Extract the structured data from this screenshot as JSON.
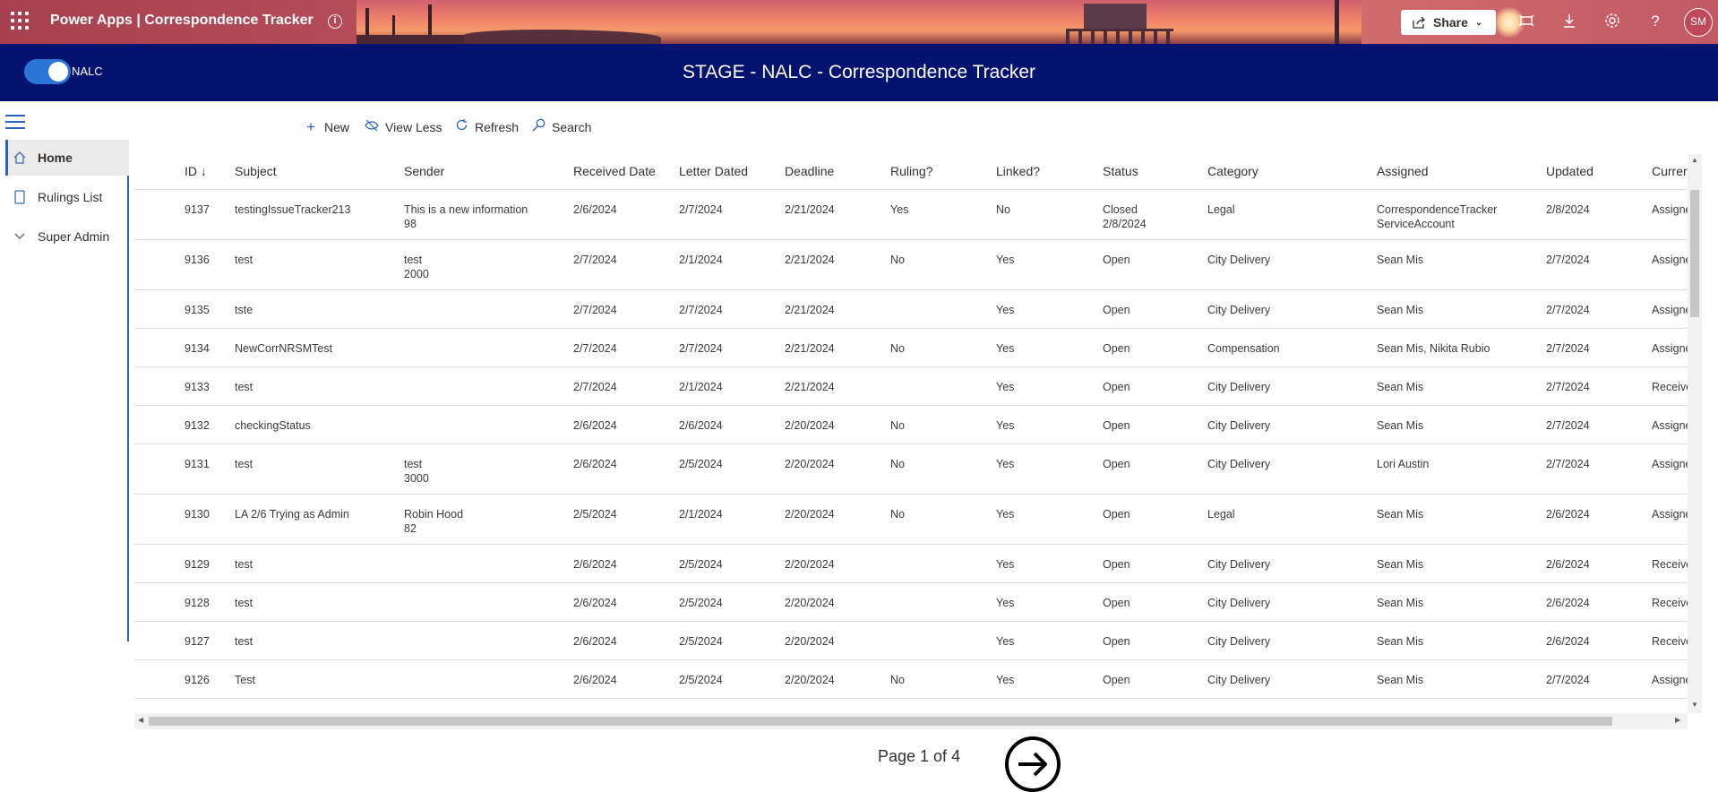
{
  "suite": {
    "app_name": "Power Apps  |  Correspondence Tracker",
    "share_label": "Share",
    "avatar_initials": "SM"
  },
  "header": {
    "toggle_label": "NALC",
    "title": "STAGE - NALC - Correspondence Tracker"
  },
  "nav": {
    "items": [
      {
        "label": "Home",
        "icon": "home-icon",
        "active": true
      },
      {
        "label": "Rulings List",
        "icon": "document-icon",
        "active": false
      },
      {
        "label": "Super Admin",
        "icon": "chevron-down-icon",
        "active": false
      }
    ]
  },
  "commands": {
    "new": "New",
    "view_less": "View Less",
    "refresh": "Refresh",
    "search": "Search"
  },
  "grid": {
    "columns": [
      "ID ↓",
      "Subject",
      "Sender",
      "Received Date",
      "Letter Dated",
      "Deadline",
      "Ruling?",
      "Linked?",
      "Status",
      "Category",
      "Assigned",
      "Updated",
      "Curren"
    ],
    "rows": [
      [
        "9137",
        "testingIssueTracker213",
        "This is a new information",
        "98",
        "2/6/2024",
        "2/7/2024",
        "2/21/2024",
        "Yes",
        "No",
        "Closed",
        "2/8/2024",
        "Legal",
        "CorrespondenceTracker",
        "ServiceAccount",
        "2/8/2024",
        "Assigne"
      ],
      [
        "9136",
        "test",
        "test",
        "2000",
        "2/7/2024",
        "2/1/2024",
        "2/21/2024",
        "No",
        "Yes",
        "Open",
        "",
        "City Delivery",
        "Sean Mis",
        "",
        "2/7/2024",
        "Assigne"
      ],
      [
        "9135",
        "tste",
        "",
        "",
        "2/7/2024",
        "2/7/2024",
        "2/21/2024",
        "",
        "Yes",
        "Open",
        "",
        "City Delivery",
        "Sean Mis",
        "",
        "2/7/2024",
        "Assigne"
      ],
      [
        "9134",
        "NewCorrNRSMTest",
        "",
        "",
        "2/7/2024",
        "2/7/2024",
        "2/21/2024",
        "No",
        "Yes",
        "Open",
        "",
        "Compensation",
        "Sean Mis, Nikita Rubio",
        "",
        "2/7/2024",
        "Assigne"
      ],
      [
        "9133",
        "test",
        "",
        "",
        "2/7/2024",
        "2/1/2024",
        "2/21/2024",
        "",
        "Yes",
        "Open",
        "",
        "City Delivery",
        "Sean Mis",
        "",
        "2/7/2024",
        "Receive"
      ],
      [
        "9132",
        "checkingStatus",
        "",
        "",
        "2/6/2024",
        "2/6/2024",
        "2/20/2024",
        "No",
        "Yes",
        "Open",
        "",
        "City Delivery",
        "Sean Mis",
        "",
        "2/7/2024",
        "Assigne"
      ],
      [
        "9131",
        "test",
        "test",
        "3000",
        "2/6/2024",
        "2/5/2024",
        "2/20/2024",
        "No",
        "Yes",
        "Open",
        "",
        "City Delivery",
        "Lori Austin",
        "",
        "2/7/2024",
        "Assigne"
      ],
      [
        "9130",
        "LA 2/6 Trying as Admin",
        "Robin Hood",
        "82",
        "2/5/2024",
        "2/1/2024",
        "2/20/2024",
        "No",
        "Yes",
        "Open",
        "",
        "Legal",
        "Sean Mis",
        "",
        "2/6/2024",
        "Assigne"
      ],
      [
        "9129",
        "test",
        "",
        "",
        "2/6/2024",
        "2/5/2024",
        "2/20/2024",
        "",
        "Yes",
        "Open",
        "",
        "City Delivery",
        "Sean Mis",
        "",
        "2/6/2024",
        "Receive"
      ],
      [
        "9128",
        "test",
        "",
        "",
        "2/6/2024",
        "2/5/2024",
        "2/20/2024",
        "",
        "Yes",
        "Open",
        "",
        "City Delivery",
        "Sean Mis",
        "",
        "2/6/2024",
        "Receive"
      ],
      [
        "9127",
        "test",
        "",
        "",
        "2/6/2024",
        "2/5/2024",
        "2/20/2024",
        "",
        "Yes",
        "Open",
        "",
        "City Delivery",
        "Sean Mis",
        "",
        "2/6/2024",
        "Receive"
      ],
      [
        "9126",
        "Test",
        "",
        "",
        "2/6/2024",
        "2/5/2024",
        "2/20/2024",
        "No",
        "Yes",
        "Open",
        "",
        "City Delivery",
        "Sean Mis",
        "",
        "2/7/2024",
        "Assigne"
      ]
    ]
  },
  "paging": {
    "label": "Page 1 of 4"
  }
}
